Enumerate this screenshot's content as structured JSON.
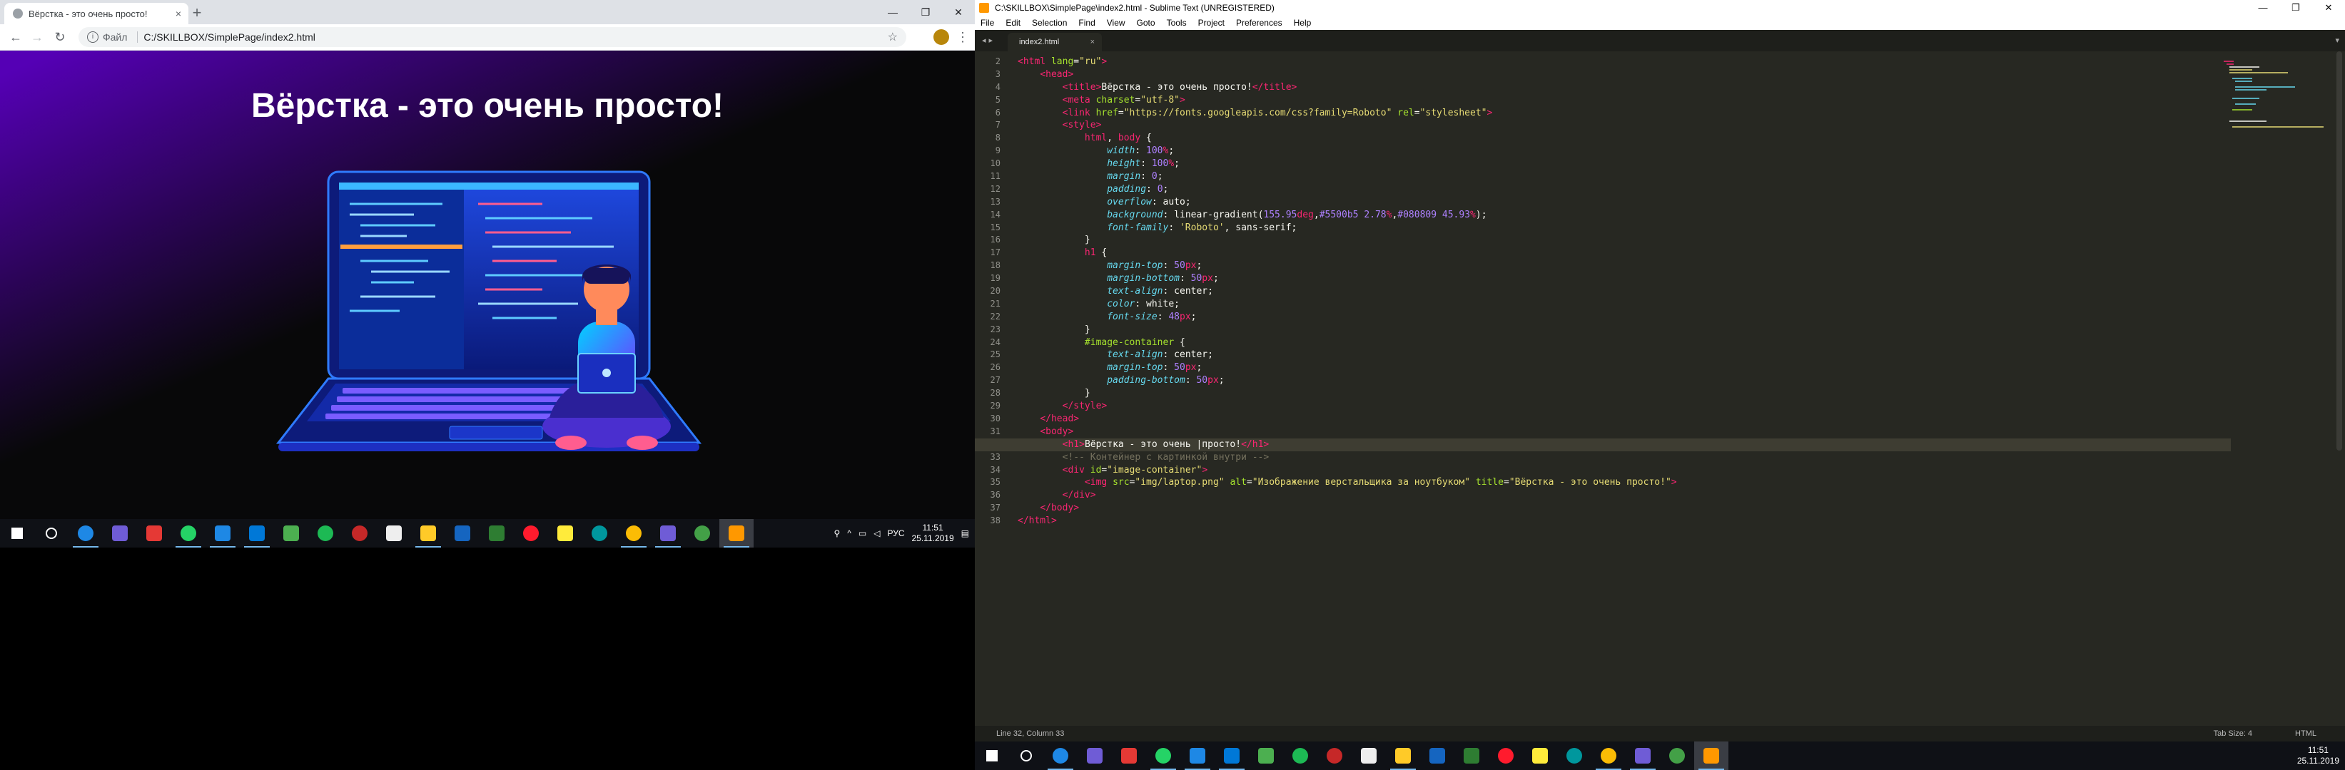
{
  "chrome": {
    "tab_title": "Вёрстка - это очень просто!",
    "tab_close": "×",
    "new_tab": "+",
    "win_min": "—",
    "win_max": "❐",
    "win_close": "✕",
    "nav_back": "←",
    "nav_forward": "→",
    "nav_reload": "↻",
    "info_glyph": "i",
    "url_label": "Файл",
    "url": "C:/SKILLBOX/SimplePage/index2.html",
    "star": "☆",
    "menu": "⋮"
  },
  "page": {
    "heading": "Вёрстка - это очень просто!",
    "image_alt": "Изображение верстальщика за ноутбуком"
  },
  "taskbar_left": {
    "lang": "РУС",
    "time": "11:51",
    "date": "25.11.2019",
    "icons": [
      "start-icon",
      "search-icon",
      "ie-icon",
      "tools-icon",
      "app-red-icon",
      "whatsapp-icon",
      "messenger-icon",
      "calendar-icon",
      "store-icon",
      "spotify-icon",
      "media-icon",
      "calculator-icon",
      "explorer-icon",
      "sound-icon",
      "app-green-icon",
      "opera-icon",
      "game-icon",
      "arduino-icon",
      "chrome-icon",
      "tools2-icon",
      "app-green2-icon",
      "sublime-icon"
    ]
  },
  "taskbar_right": {
    "time": "11:51",
    "date": "25.11.2019"
  },
  "sublime": {
    "title": "C:\\SKILLBOX\\SimplePage\\index2.html - Sublime Text (UNREGISTERED)",
    "menu": [
      "File",
      "Edit",
      "Selection",
      "Find",
      "View",
      "Goto",
      "Tools",
      "Project",
      "Preferences",
      "Help"
    ],
    "tab": "index2.html",
    "tab_close": "×",
    "status_left": "Line 32, Column 33",
    "status_tab": "Tab Size: 4",
    "status_syntax": "HTML",
    "line_numbers": [
      "2",
      "3",
      "4",
      "5",
      "6",
      "7",
      "8",
      "9",
      "10",
      "11",
      "12",
      "13",
      "14",
      "15",
      "16",
      "17",
      "18",
      "19",
      "20",
      "21",
      "22",
      "23",
      "24",
      "25",
      "26",
      "27",
      "28",
      "29",
      "30",
      "31",
      "32",
      "33",
      "34",
      "35",
      "36",
      "37",
      "38"
    ]
  },
  "colors": {
    "gradient_start": "#5500b5",
    "gradient_end": "#080809",
    "editor_bg": "#272822",
    "tag": "#f92672",
    "attr": "#a6e22e",
    "string": "#e6db74",
    "property": "#66d9ef",
    "number": "#ae81ff",
    "comment": "#75715e"
  }
}
